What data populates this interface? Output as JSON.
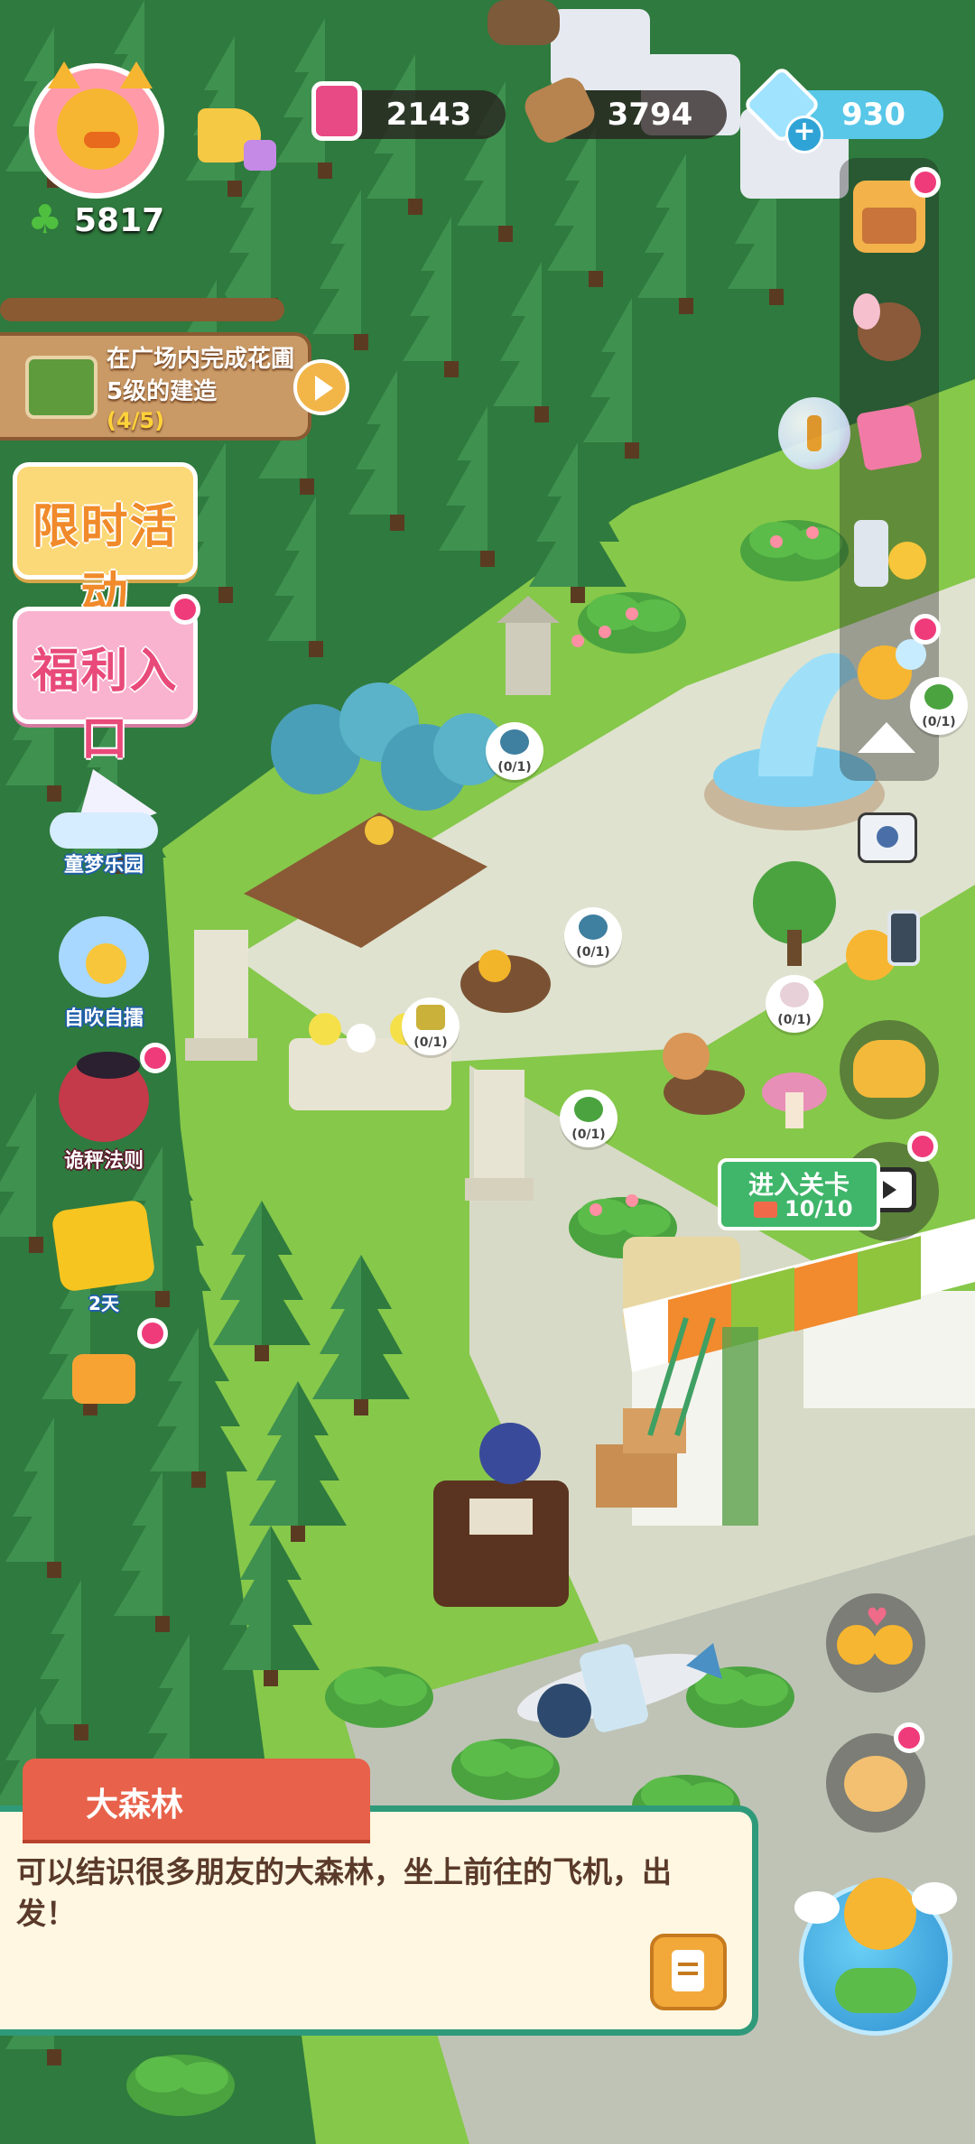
{
  "player": {
    "clover_count": "5817"
  },
  "resources": [
    {
      "name": "jam",
      "value": "2143",
      "icon": "jam-jar-icon"
    },
    {
      "name": "wood",
      "value": "3794",
      "icon": "log-icon"
    },
    {
      "name": "gem",
      "value": "930",
      "icon": "blue-gem-icon"
    }
  ],
  "task": {
    "text": "在广场内完成花圃5级的建造",
    "progress": "(4/5)"
  },
  "left_buttons": {
    "event": "限时活动",
    "welfare": "福利入口",
    "dream_park": "童梦乐园",
    "self_blow": "自吹自擂",
    "rules": "诡秤法则",
    "timer": "2天"
  },
  "bubbles": [
    "(0/1)",
    "(0/1)",
    "(0/1)",
    "(0/1)",
    "(0/1)",
    "(0/1)"
  ],
  "level_sign": {
    "label": "进入关卡",
    "count": "10/10"
  },
  "location_panel": {
    "title": "大森林",
    "description": "可以结识很多朋友的大森林，坐上前往的飞机，出发！"
  },
  "colors": {
    "grass": "#7cbf3f",
    "forest": "#2f7a3e",
    "path": "#d9dcc5",
    "accent_red": "#e8614a",
    "panel_border": "#2f9a7a",
    "panel_bg": "#fff7e2"
  }
}
